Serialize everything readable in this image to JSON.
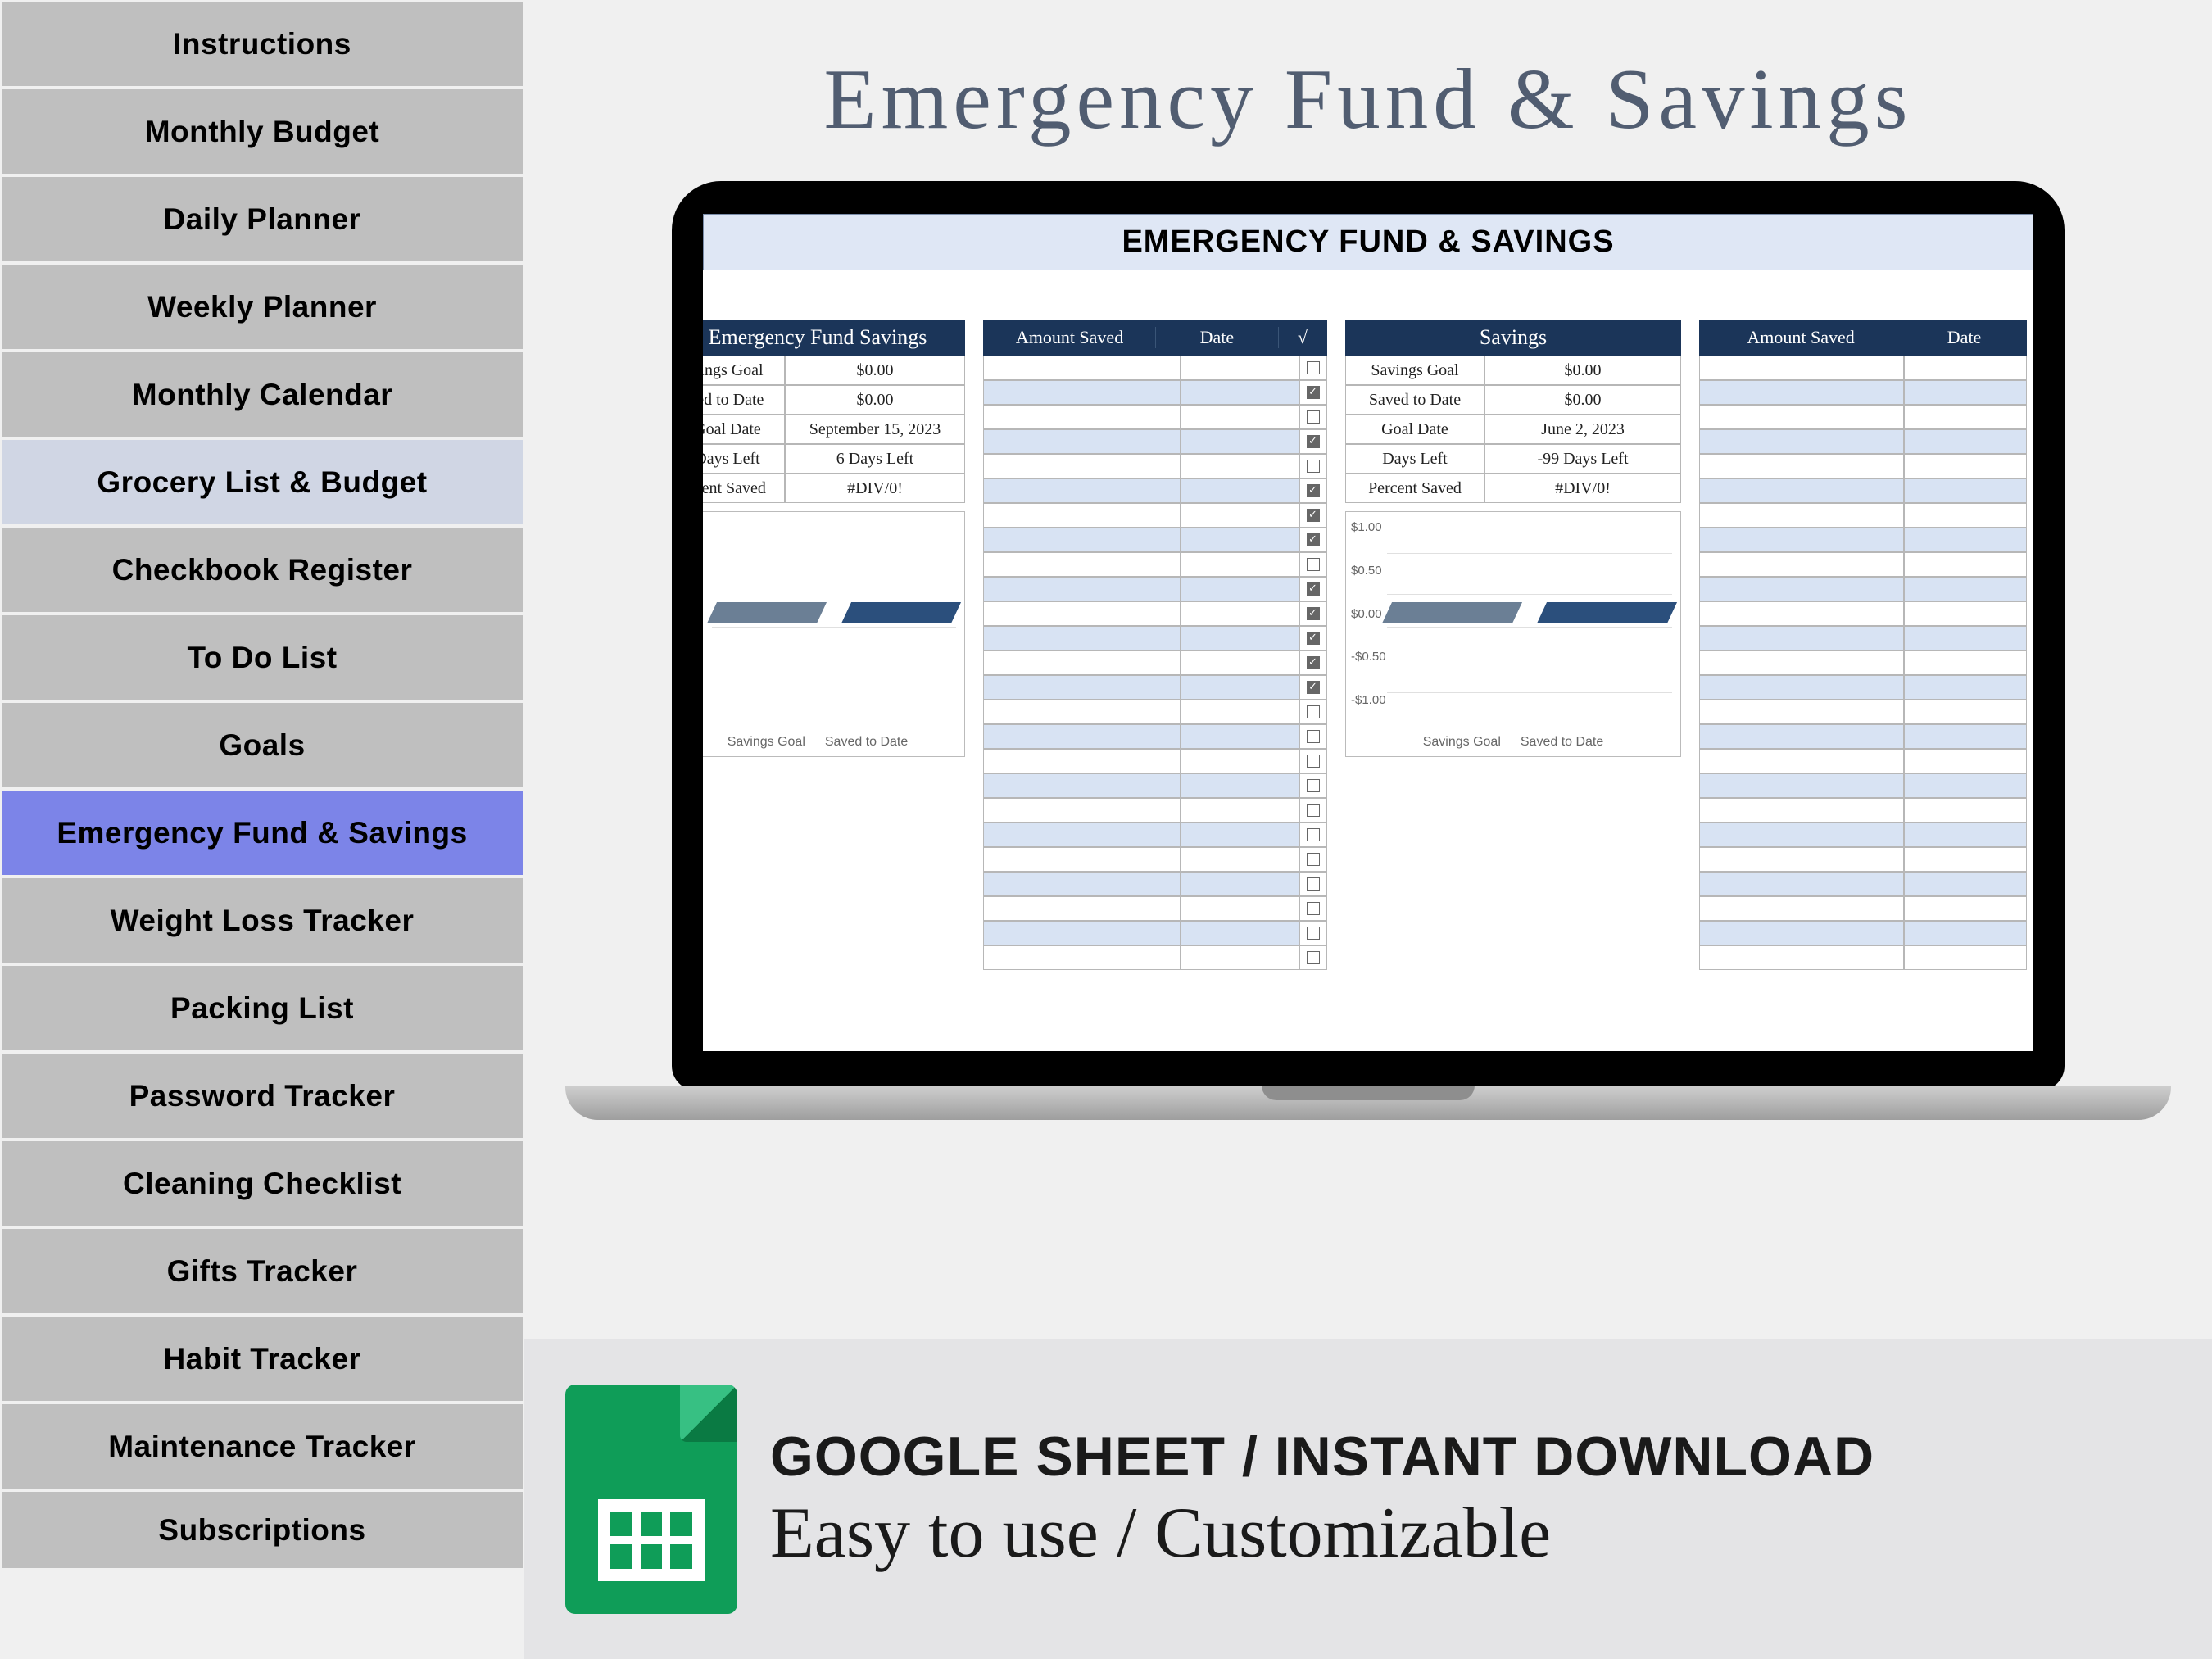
{
  "sidebar": {
    "items": [
      {
        "label": "Instructions",
        "state": ""
      },
      {
        "label": "Monthly Budget",
        "state": ""
      },
      {
        "label": "Daily Planner",
        "state": ""
      },
      {
        "label": "Weekly Planner",
        "state": ""
      },
      {
        "label": "Monthly Calendar",
        "state": ""
      },
      {
        "label": "Grocery List & Budget",
        "state": "highlight"
      },
      {
        "label": "Checkbook Register",
        "state": ""
      },
      {
        "label": "To Do List",
        "state": ""
      },
      {
        "label": "Goals",
        "state": ""
      },
      {
        "label": "Emergency Fund & Savings",
        "state": "active"
      },
      {
        "label": "Weight Loss Tracker",
        "state": ""
      },
      {
        "label": "Packing List",
        "state": ""
      },
      {
        "label": "Password Tracker",
        "state": ""
      },
      {
        "label": "Cleaning Checklist",
        "state": ""
      },
      {
        "label": "Gifts Tracker",
        "state": ""
      },
      {
        "label": "Habit Tracker",
        "state": ""
      },
      {
        "label": "Maintenance Tracker",
        "state": ""
      },
      {
        "label": "Subscriptions",
        "state": ""
      }
    ]
  },
  "page_title": "Emergency Fund & Savings",
  "sheet": {
    "title": "EMERGENCY FUND & SAVINGS",
    "block1": {
      "header": "Emergency Fund Savings",
      "rows": [
        {
          "k": "vings Goal",
          "v": "$0.00"
        },
        {
          "k": "red to Date",
          "v": "$0.00"
        },
        {
          "k": "Goal Date",
          "v": "September 15, 2023"
        },
        {
          "k": "Days Left",
          "v": "6 Days Left"
        },
        {
          "k": "rcent Saved",
          "v": "#DIV/0!"
        }
      ]
    },
    "block2": {
      "header": "Emergency Fund Savings",
      "cols": {
        "a": "Amount Saved",
        "b": "Date",
        "c": "√"
      },
      "checks": [
        false,
        true,
        false,
        true,
        false,
        true,
        true,
        true,
        false,
        true,
        true,
        true,
        true,
        true,
        false,
        false,
        false,
        false,
        false,
        false,
        false,
        false,
        false,
        false,
        false
      ]
    },
    "block3": {
      "header": "Savings",
      "rows": [
        {
          "k": "Savings Goal",
          "v": "$0.00"
        },
        {
          "k": "Saved to Date",
          "v": "$0.00"
        },
        {
          "k": "Goal Date",
          "v": "June 2, 2023"
        },
        {
          "k": "Days Left",
          "v": "-99 Days Left"
        },
        {
          "k": "Percent Saved",
          "v": "#DIV/0!"
        }
      ]
    },
    "block4": {
      "header": "Savings",
      "cols": {
        "a": "Amount Saved",
        "b": "Date"
      }
    },
    "chart": {
      "legend_a": "Savings Goal",
      "legend_b": "Saved to Date",
      "axis2": [
        "$1.00",
        "$0.50",
        "$0.00",
        "-$0.50",
        "-$1.00"
      ]
    }
  },
  "chart_data": [
    {
      "type": "bar",
      "title": "",
      "categories": [
        "Savings Goal",
        "Saved to Date"
      ],
      "values": [
        0,
        0
      ],
      "xlabel": "",
      "ylabel": "",
      "ylim": [
        0,
        1
      ]
    },
    {
      "type": "bar",
      "title": "",
      "categories": [
        "Savings Goal",
        "Saved to Date"
      ],
      "values": [
        0,
        0
      ],
      "xlabel": "",
      "ylabel": "",
      "ylim": [
        -1,
        1
      ]
    }
  ],
  "footer": {
    "line1": "GOOGLE SHEET / INSTANT DOWNLOAD",
    "line2": "Easy to use / Customizable"
  }
}
